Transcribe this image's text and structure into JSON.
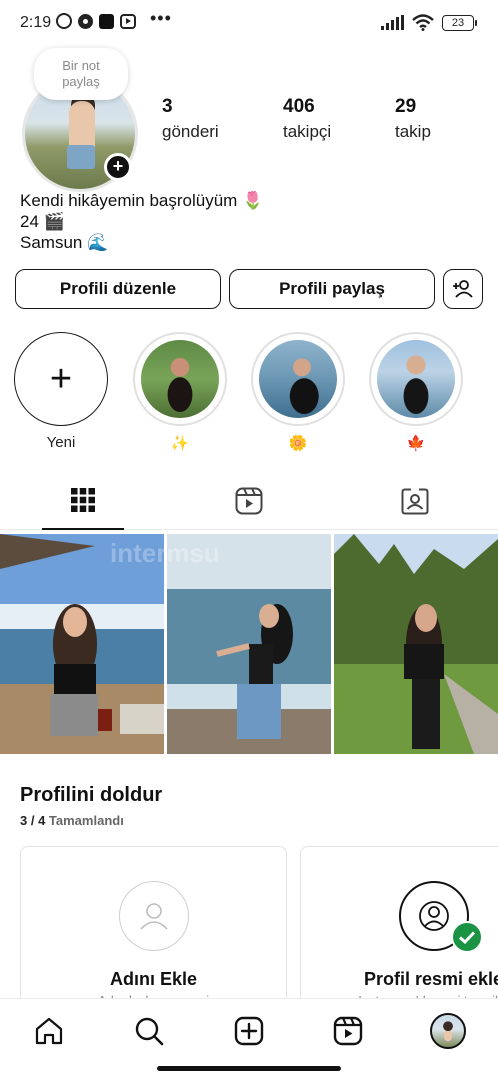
{
  "status_bar": {
    "time": "2:19",
    "battery": "23"
  },
  "profile": {
    "note_placeholder_line1": "Bir not",
    "note_placeholder_line2": "paylaş",
    "stats": [
      {
        "value": "3",
        "label": "gönderi"
      },
      {
        "value": "406",
        "label": "takipçi"
      },
      {
        "value": "29",
        "label": "takip"
      }
    ],
    "bio": [
      "Kendi hikâyemin başrolüyüm 🌷",
      "24 🎬",
      "Samsun 🌊"
    ]
  },
  "actions": {
    "edit_label": "Profili düzenle",
    "share_label": "Profili paylaş"
  },
  "highlights": [
    {
      "label": "Yeni",
      "type": "new"
    },
    {
      "label": "✨",
      "type": "story"
    },
    {
      "label": "🌼",
      "type": "story"
    },
    {
      "label": "🍁",
      "type": "story"
    }
  ],
  "tabs": [
    {
      "icon": "grid-icon",
      "active": true
    },
    {
      "icon": "reels-icon",
      "active": false
    },
    {
      "icon": "tagged-icon",
      "active": false
    }
  ],
  "grid_watermark": "intermsu",
  "complete_profile": {
    "title": "Profilini doldur",
    "progress_count": "3 / 4",
    "progress_label": "Tamamlandı",
    "cards": [
      {
        "title": "Adını Ekle",
        "subtitle": "Arkadaşlarının seni"
      },
      {
        "title": "Profil resmi ekle",
        "subtitle": "Instagram'da seni temsil e"
      }
    ]
  },
  "bottom_nav": [
    "home-icon",
    "search-icon",
    "create-icon",
    "reels-icon",
    "profile-avatar"
  ]
}
